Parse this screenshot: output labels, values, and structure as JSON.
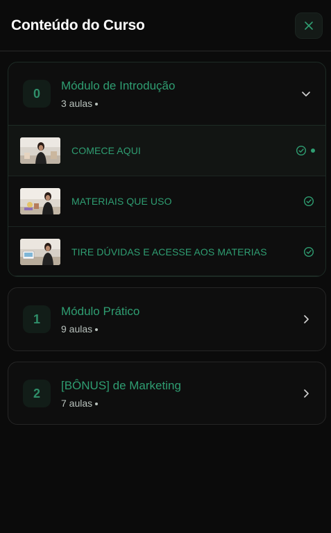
{
  "header": {
    "title": "Conteúdo do Curso",
    "close_icon": "close-icon"
  },
  "colors": {
    "background": "#0b0b0b",
    "accent": "#2f9e72",
    "card_border": "#262626"
  },
  "modules": [
    {
      "number": "0",
      "title": "Módulo de Introdução",
      "meta": "3 aulas",
      "expanded": true,
      "chevron_icon": "chevron-down-icon",
      "lessons": [
        {
          "title": "COMECE AQUI",
          "completed": true,
          "active": true,
          "status_icon": "check-circle-icon"
        },
        {
          "title": "MATERIAIS QUE USO",
          "completed": true,
          "active": false,
          "status_icon": "check-circle-icon"
        },
        {
          "title": "TIRE DÚVIDAS E ACESSE AOS MATERIAS",
          "completed": true,
          "active": false,
          "status_icon": "check-circle-icon"
        }
      ]
    },
    {
      "number": "1",
      "title": "Módulo Prático",
      "meta": "9 aulas",
      "expanded": false,
      "chevron_icon": "chevron-right-icon"
    },
    {
      "number": "2",
      "title": "[BÔNUS] de Marketing",
      "meta": "7 aulas",
      "expanded": false,
      "chevron_icon": "chevron-right-icon"
    }
  ]
}
